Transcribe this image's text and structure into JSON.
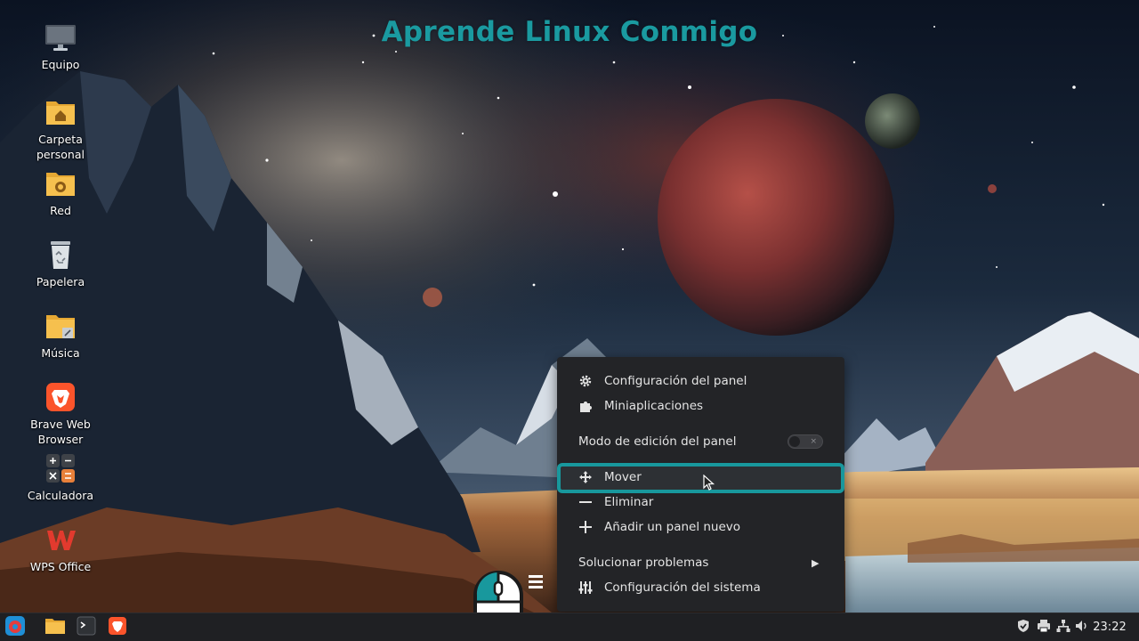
{
  "watermark": {
    "text": "Aprende Linux Conmigo",
    "color": "#1a9aa0"
  },
  "desktop": {
    "icons": [
      {
        "label": "Equipo",
        "icon": "monitor-icon"
      },
      {
        "label": "Carpeta personal",
        "icon": "home-folder-icon"
      },
      {
        "label": "Red",
        "icon": "network-folder-icon"
      },
      {
        "label": "Papelera",
        "icon": "trash-icon"
      },
      {
        "label": "Música",
        "icon": "music-folder-icon"
      },
      {
        "label": "Brave Web Browser",
        "icon": "brave-icon"
      },
      {
        "label": "Calculadora",
        "icon": "calculator-icon"
      },
      {
        "label": "WPS Office",
        "icon": "wps-office-icon"
      }
    ]
  },
  "context_menu": {
    "items": [
      {
        "label": "Configuración del panel",
        "icon": "gear-icon"
      },
      {
        "label": "Miniaplicaciones",
        "icon": "puzzle-icon"
      },
      {
        "label": "Modo de edición del panel",
        "toggle_state": "off"
      },
      {
        "label": "Mover",
        "icon": "move-icon",
        "highlighted": true
      },
      {
        "label": "Eliminar",
        "icon": "minus-icon"
      },
      {
        "label": "Añadir un panel nuevo",
        "icon": "plus-icon"
      },
      {
        "label": "Solucionar problemas",
        "submenu": true
      },
      {
        "label": "Configuración del sistema",
        "icon": "sliders-icon"
      }
    ],
    "toggle_off_glyph": "×",
    "submenu_arrow": "▶",
    "highlight_color": "#18989d"
  },
  "taskbar": {
    "launchers": [
      "menu-icon",
      "file-manager-icon",
      "terminal-icon",
      "brave-icon"
    ],
    "tray": [
      "shield-update-icon",
      "printer-icon",
      "network-icon",
      "volume-icon"
    ],
    "clock": "23:22"
  }
}
